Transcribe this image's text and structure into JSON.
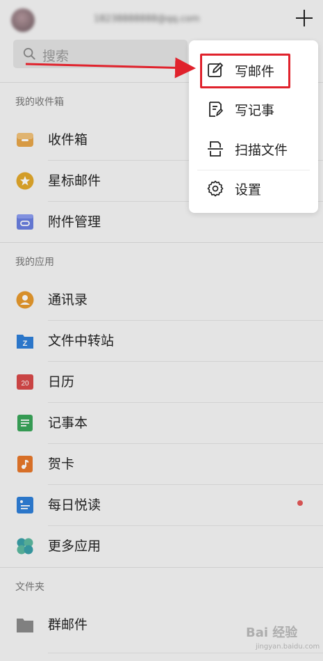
{
  "header": {
    "account_email": "18238888888@qq.com",
    "search_placeholder": "搜索"
  },
  "sections": {
    "mailbox_title": "我的收件箱",
    "apps_title": "我的应用",
    "folders_title": "文件夹"
  },
  "mailbox_items": [
    {
      "label": "收件箱",
      "icon": "inbox-tray-icon",
      "color": "#e8a64a"
    },
    {
      "label": "星标邮件",
      "icon": "star-icon",
      "color": "#e3a92c"
    },
    {
      "label": "附件管理",
      "icon": "attachment-icon",
      "color": "#6a7fe0"
    }
  ],
  "app_items": [
    {
      "label": "通讯录",
      "icon": "contacts-icon",
      "color": "#e89a2e"
    },
    {
      "label": "文件中转站",
      "icon": "file-transfer-icon",
      "color": "#2f7fd9"
    },
    {
      "label": "日历",
      "icon": "calendar-icon",
      "color": "#d94a4a",
      "icon_text": "20"
    },
    {
      "label": "记事本",
      "icon": "notebook-icon",
      "color": "#3aa65a"
    },
    {
      "label": "贺卡",
      "icon": "greeting-card-icon",
      "color": "#e8782a"
    },
    {
      "label": "每日悦读",
      "icon": "daily-reading-icon",
      "color": "#2f7fd9"
    },
    {
      "label": "更多应用",
      "icon": "more-apps-icon",
      "color": "#3aa0a8"
    }
  ],
  "folder_items": [
    {
      "label": "群邮件",
      "icon": "folder-icon",
      "color": "#8a8a8a"
    }
  ],
  "menu": {
    "items": [
      {
        "label": "写邮件",
        "icon": "compose-icon"
      },
      {
        "label": "写记事",
        "icon": "write-note-icon"
      },
      {
        "label": "扫描文件",
        "icon": "scan-icon"
      },
      {
        "label": "设置",
        "icon": "settings-gear-icon"
      }
    ]
  },
  "watermark": {
    "brand": "Bai 经验",
    "url": "jingyan.baidu.com"
  },
  "colors": {
    "highlight": "#e0222c",
    "unread_dot": "#e55959"
  }
}
